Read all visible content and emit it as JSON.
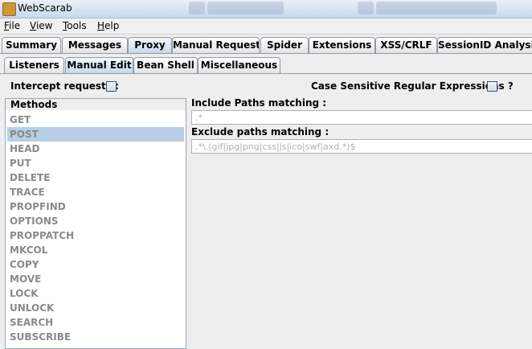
{
  "window": {
    "title": "WebScarab"
  },
  "menu": [
    {
      "label": "File",
      "underline": "F",
      "rest": "ile"
    },
    {
      "label": "View",
      "underline": "V",
      "rest": "iew"
    },
    {
      "label": "Tools",
      "underline": "T",
      "rest": "ools"
    },
    {
      "label": "Help",
      "underline": "H",
      "rest": "elp"
    }
  ],
  "main_tabs": [
    {
      "label": "Summary",
      "active": false
    },
    {
      "label": "Messages",
      "active": false
    },
    {
      "label": "Proxy",
      "active": true
    },
    {
      "label": "Manual Request",
      "active": false
    },
    {
      "label": "Spider",
      "active": false
    },
    {
      "label": "Extensions",
      "active": false
    },
    {
      "label": "XSS/CRLF",
      "active": false
    },
    {
      "label": "SessionID Analysis",
      "active": false
    }
  ],
  "sub_tabs": [
    {
      "label": "Listeners",
      "active": false
    },
    {
      "label": "Manual Edit",
      "active": true
    },
    {
      "label": "Bean Shell",
      "active": false
    },
    {
      "label": "Miscellaneous",
      "active": false
    }
  ],
  "intercept": {
    "label": "Intercept requests :",
    "checked": false
  },
  "case_sensitive": {
    "label": "Case Sensitive Regular Expressions ?",
    "checked": false
  },
  "methods": {
    "title": "Methods",
    "selected": "POST",
    "items": [
      "GET",
      "POST",
      "HEAD",
      "PUT",
      "DELETE",
      "TRACE",
      "PROPFIND",
      "OPTIONS",
      "PROPPATCH",
      "MKCOL",
      "COPY",
      "MOVE",
      "LOCK",
      "UNLOCK",
      "SEARCH",
      "SUBSCRIBE"
    ]
  },
  "include_paths": {
    "label": "Include Paths matching :",
    "value": ".*"
  },
  "exclude_paths": {
    "label": "Exclude paths matching :",
    "value": ".*\\.(gif|jpg|png|css|js|ico|swf|axd.*)$"
  }
}
